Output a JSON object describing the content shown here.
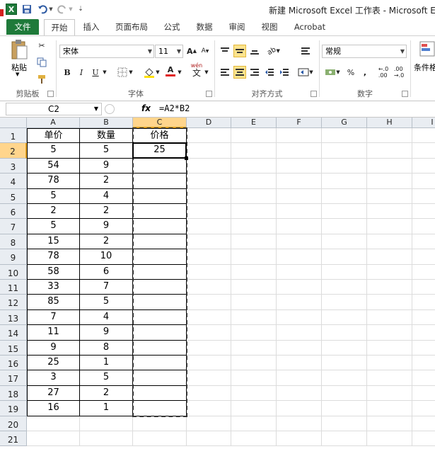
{
  "window": {
    "title": "新建 Microsoft Excel 工作表 - Microsoft Excel"
  },
  "quick_access": [
    "save-icon",
    "undo-icon",
    "redo-icon",
    "customize-icon"
  ],
  "tabs": [
    {
      "label": "文件"
    },
    {
      "label": "开始"
    },
    {
      "label": "插入"
    },
    {
      "label": "页面布局"
    },
    {
      "label": "公式"
    },
    {
      "label": "数据"
    },
    {
      "label": "审阅"
    },
    {
      "label": "视图"
    },
    {
      "label": "Acrobat"
    }
  ],
  "ribbon": {
    "clipboard": {
      "paste_label": "粘贴",
      "group_label": "剪贴板"
    },
    "font": {
      "font_name": "宋体",
      "font_size": "11",
      "bold": "B",
      "italic": "I",
      "underline": "U",
      "grow": "A",
      "shrink": "A",
      "wen": "wén",
      "wen_char": "文",
      "group_label": "字体"
    },
    "alignment": {
      "group_label": "对齐方式"
    },
    "number": {
      "format": "常规",
      "percent": "%",
      "comma": ",",
      "group_label": "数字"
    },
    "styles": {
      "cond_format_label": "条件格"
    }
  },
  "formula_bar": {
    "name_box": "C2",
    "fx": "fx",
    "formula": "=A2*B2"
  },
  "columns": [
    "A",
    "B",
    "C",
    "D",
    "E",
    "F",
    "G",
    "H",
    "I"
  ],
  "table": {
    "headers": [
      "单价",
      "数量",
      "价格"
    ],
    "rows": [
      [
        "5",
        "5",
        "25"
      ],
      [
        "54",
        "9",
        ""
      ],
      [
        "78",
        "2",
        ""
      ],
      [
        "5",
        "4",
        ""
      ],
      [
        "2",
        "2",
        ""
      ],
      [
        "5",
        "9",
        ""
      ],
      [
        "15",
        "2",
        ""
      ],
      [
        "78",
        "10",
        ""
      ],
      [
        "58",
        "6",
        ""
      ],
      [
        "33",
        "7",
        ""
      ],
      [
        "85",
        "5",
        ""
      ],
      [
        "7",
        "4",
        ""
      ],
      [
        "11",
        "9",
        ""
      ],
      [
        "9",
        "8",
        ""
      ],
      [
        "25",
        "1",
        ""
      ],
      [
        "3",
        "5",
        ""
      ],
      [
        "27",
        "2",
        ""
      ],
      [
        "16",
        "1",
        ""
      ]
    ]
  },
  "row_numbers": [
    "1",
    "2",
    "3",
    "4",
    "5",
    "6",
    "7",
    "8",
    "9",
    "10",
    "11",
    "12",
    "13",
    "14",
    "15",
    "16",
    "17",
    "18",
    "19",
    "20",
    "21"
  ],
  "selected_cell": "C2",
  "colors": {
    "accent": "#1f7a3a",
    "selection": "#ffd58c",
    "highlight_button": "#fbe38d"
  }
}
